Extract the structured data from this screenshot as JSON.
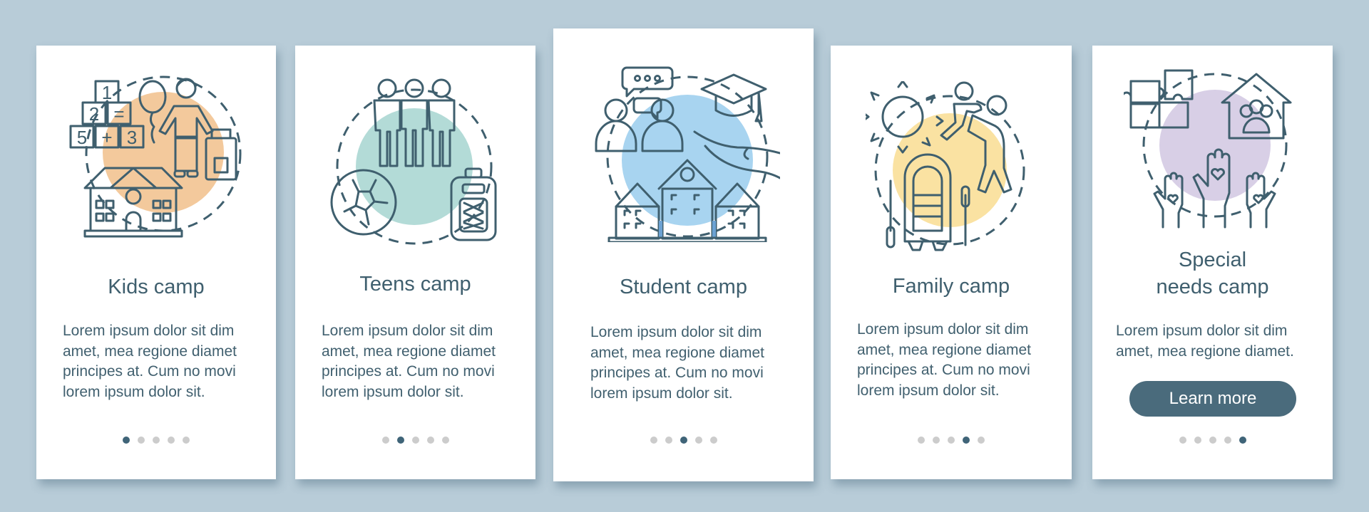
{
  "colors": {
    "background": "#b8ccd8",
    "text": "#3f5f6e",
    "dot_inactive": "#cccccc",
    "dot_active": "#3f6478",
    "button": "#4a6b7c",
    "kids_accent": "#e39b74",
    "kids_blob": "#f3c99c",
    "teens_accent": "#6dbcb2",
    "teens_blob": "#b3dbd7",
    "student_accent": "#6ca2d3",
    "student_blob": "#a8d4f0",
    "family_accent": "#f0bd5f",
    "family_blob": "#fae2a2",
    "special_accent": "#b48cc6",
    "special_blob": "#d8cfe6"
  },
  "cards": [
    {
      "title": "Kids camp",
      "illustration": "kids-camp-illustration",
      "body": "Lorem ipsum dolor sit dim\namet, mea regione diamet\nprincipes at. Cum no movi\nlorem ipsum dolor sit.",
      "active_dot": 1,
      "dots": 5
    },
    {
      "title": "Teens camp",
      "illustration": "teens-camp-illustration",
      "body": "Lorem ipsum dolor sit dim\namet, mea regione diamet\nprincipes at. Cum no movi\nlorem ipsum dolor sit.",
      "active_dot": 2,
      "dots": 5
    },
    {
      "title": "Student camp",
      "illustration": "student-camp-illustration",
      "body": "Lorem ipsum dolor sit dim\namet, mea regione diamet\nprincipes at. Cum no movi\nlorem ipsum dolor sit.",
      "active_dot": 3,
      "dots": 5
    },
    {
      "title": "Family camp",
      "illustration": "family-camp-illustration",
      "body": "Lorem ipsum dolor sit dim\namet, mea regione diamet\nprincipes at. Cum no movi\nlorem ipsum dolor sit.",
      "active_dot": 4,
      "dots": 5
    },
    {
      "title": "Special\nneeds camp",
      "illustration": "special-needs-camp-illustration",
      "body": "Lorem ipsum dolor sit dim\namet, mea regione diamet.",
      "active_dot": 5,
      "dots": 5,
      "button_label": "Learn more"
    }
  ],
  "kids_blocks": [
    "1",
    "2",
    "=",
    "5",
    "+",
    "3"
  ]
}
